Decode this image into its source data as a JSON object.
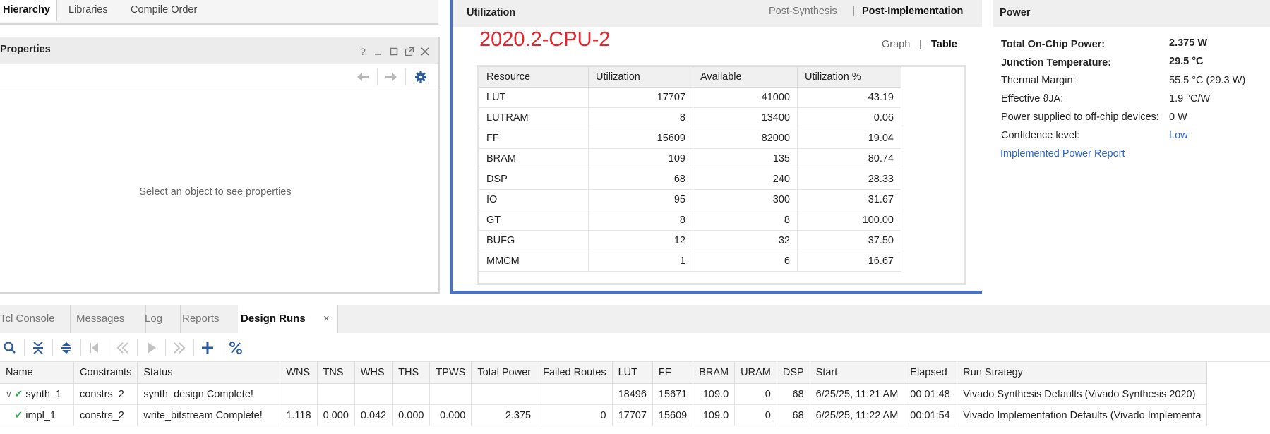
{
  "hierarchy_tabs": [
    "Hierarchy",
    "Libraries",
    "Compile Order"
  ],
  "properties": {
    "title": "Properties",
    "help_symbol": "?",
    "empty_message": "Select an object to see properties"
  },
  "utilization": {
    "title": "Utilization",
    "tabs": [
      "Post-Synthesis",
      "Post-Implementation"
    ],
    "active_tab": "Post-Implementation",
    "version_label": "2020.2-CPU-2",
    "views": [
      "Graph",
      "Table"
    ],
    "active_view": "Table",
    "columns": [
      "Resource",
      "Utilization",
      "Available",
      "Utilization %"
    ],
    "rows": [
      [
        "LUT",
        "17707",
        "41000",
        "43.19"
      ],
      [
        "LUTRAM",
        "8",
        "13400",
        "0.06"
      ],
      [
        "FF",
        "15609",
        "82000",
        "19.04"
      ],
      [
        "BRAM",
        "109",
        "135",
        "80.74"
      ],
      [
        "DSP",
        "68",
        "240",
        "28.33"
      ],
      [
        "IO",
        "95",
        "300",
        "31.67"
      ],
      [
        "GT",
        "8",
        "8",
        "100.00"
      ],
      [
        "BUFG",
        "12",
        "32",
        "37.50"
      ],
      [
        "MMCM",
        "1",
        "6",
        "16.67"
      ]
    ]
  },
  "power": {
    "title": "Power",
    "rows": [
      {
        "label": "Total On-Chip Power:",
        "value": "2.375 W",
        "bold": true
      },
      {
        "label": "Junction Temperature:",
        "value": "29.5 °C",
        "bold": true
      },
      {
        "label": "Thermal Margin:",
        "value": "55.5 °C (29.3 W)",
        "bold": false
      },
      {
        "label": "Effective ϑJA:",
        "value": "1.9 °C/W",
        "bold": false
      },
      {
        "label": "Power supplied to off-chip devices:",
        "value": "0 W",
        "bold": false
      },
      {
        "label": "Confidence level:",
        "value": "Low",
        "bold": false
      }
    ],
    "report_link": "Implemented Power Report"
  },
  "bottom_tabs": [
    "Tcl Console",
    "Messages",
    "Log",
    "Reports",
    "Design Runs"
  ],
  "active_bottom_tab": "Design Runs",
  "close_symbol": "×",
  "runs": {
    "columns": [
      "Name",
      "Constraints",
      "Status",
      "WNS",
      "TNS",
      "WHS",
      "THS",
      "TPWS",
      "Total Power",
      "Failed Routes",
      "LUT",
      "FF",
      "BRAM",
      "URAM",
      "DSP",
      "Start",
      "Elapsed",
      "Run Strategy"
    ],
    "rows": [
      {
        "name": "synth_1",
        "constraints": "constrs_2",
        "status": "synth_design Complete!",
        "wns": "",
        "tns": "",
        "whs": "",
        "ths": "",
        "tpws": "",
        "total_power": "",
        "failed_routes": "",
        "lut": "18496",
        "ff": "15671",
        "bram": "109.0",
        "uram": "0",
        "dsp": "68",
        "start": "6/25/25, 11:21 AM",
        "elapsed": "00:01:48",
        "strategy": "Vivado Synthesis Defaults (Vivado Synthesis 2020)"
      },
      {
        "name": "impl_1",
        "constraints": "constrs_2",
        "status": "write_bitstream Complete!",
        "wns": "1.118",
        "tns": "0.000",
        "whs": "0.042",
        "ths": "0.000",
        "tpws": "0.000",
        "total_power": "2.375",
        "failed_routes": "0",
        "lut": "17707",
        "ff": "15609",
        "bram": "109.0",
        "uram": "0",
        "dsp": "68",
        "start": "6/25/25, 11:22 AM",
        "elapsed": "00:01:54",
        "strategy": "Vivado Implementation Defaults (Vivado Implementa"
      }
    ]
  },
  "colors": {
    "accent_border": "#4a72c4",
    "version_label": "#e8232a",
    "link": "#2b62c9",
    "check": "#2da44e",
    "toolbar_icon": "#2a5b9e"
  }
}
